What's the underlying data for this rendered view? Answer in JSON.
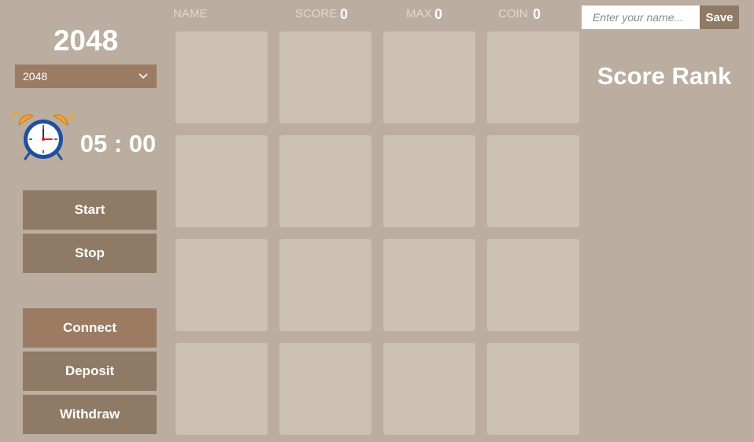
{
  "game": {
    "title": "2048",
    "selected_mode": "2048"
  },
  "timer": {
    "display": "05 : 00"
  },
  "buttons": {
    "start": "Start",
    "stop": "Stop",
    "connect": "Connect",
    "deposit": "Deposit",
    "withdraw": "Withdraw"
  },
  "header": {
    "name_label": "NAME",
    "score_label": "SCORE",
    "score_value": "0",
    "max_label": "MAX",
    "max_value": "0",
    "coin_label": "COIN",
    "coin_value": "0"
  },
  "board": {
    "rows": 4,
    "cols": 4,
    "tiles": [
      [
        "",
        "",
        "",
        ""
      ],
      [
        "",
        "",
        "",
        ""
      ],
      [
        "",
        "",
        "",
        ""
      ],
      [
        "",
        "",
        "",
        ""
      ]
    ]
  },
  "name_entry": {
    "placeholder": "Enter your name...",
    "value": "",
    "save_label": "Save"
  },
  "rank": {
    "title": "Score Rank"
  },
  "icons": {
    "dropdown": "chevron-down-icon",
    "timer": "alarm-clock-icon"
  },
  "colors": {
    "background": "#bbada0",
    "empty_cell": "#cdc1b4",
    "button": "#8f7a66",
    "accent_button": "#9b7c63",
    "clock_body": "#1e4fa0",
    "clock_bells": "#f4a324"
  }
}
